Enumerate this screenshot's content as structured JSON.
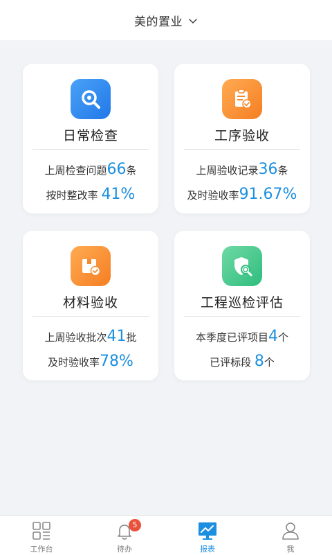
{
  "header": {
    "title": "美的置业",
    "dropdown_icon": "chevron-down-icon"
  },
  "cards": [
    {
      "title": "日常检查",
      "icon": "search-icon",
      "icon_color": "#2f8bf0",
      "line1_prefix": "上周检查问题",
      "line1_value": "66",
      "line1_suffix": "条",
      "line2_prefix": "按时整改率 ",
      "line2_value": "41%"
    },
    {
      "title": "工序验收",
      "icon": "clipboard-check-icon",
      "icon_color": "#f5923a",
      "line1_prefix": "上周验收记录",
      "line1_value": "36",
      "line1_suffix": "条",
      "line2_prefix": "及时验收率",
      "line2_value": "91.67%"
    },
    {
      "title": "材料验收",
      "icon": "package-check-icon",
      "icon_color": "#f5923a",
      "line1_prefix": "上周验收批次",
      "line1_value": "41",
      "line1_suffix": "批",
      "line2_prefix": "及时验收率",
      "line2_value": "78%"
    },
    {
      "title": "工程巡检评估",
      "icon": "shield-search-icon",
      "icon_color": "#3fc68a",
      "line1_prefix": "本季度已评项目",
      "line1_value": "4",
      "line1_suffix": "个",
      "line2_prefix": "已评标段 ",
      "line2_value": "8",
      "line2_suffix": "个"
    }
  ],
  "tabbar": {
    "tabs": [
      {
        "label": "工作台",
        "icon": "grid-icon"
      },
      {
        "label": "待办",
        "icon": "bell-icon",
        "badge": "5"
      },
      {
        "label": "报表",
        "icon": "chart-icon",
        "active": true
      },
      {
        "label": "我",
        "icon": "user-icon"
      }
    ],
    "accent_color": "#1c8fe0"
  }
}
